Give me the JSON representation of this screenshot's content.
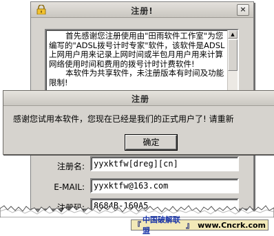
{
  "register_window": {
    "title": "注册!",
    "close_glyph": "×",
    "intro_paragraph_1": "首先感谢您注册使用由\"田雨软件工作室\"为您编写的\"ADSL拨号计时专家\"软件，该软件是ADSL上网用户用来记录上网时间或半包月用户用来计算网络使用时间和费用的拨号计时计费软件!",
    "intro_paragraph_2": "本软件为共享软件，未注册版本有时间及功能限制!",
    "fields": [
      {
        "label": "注册名:",
        "value": "yyxktfw[dreg][cn]"
      },
      {
        "label": "E-MAIL:",
        "value": "yyxktfw@163.com"
      },
      {
        "label": "注册码:",
        "value": "8684B-169A5"
      }
    ]
  },
  "message_box": {
    "title": "注册",
    "message": "感谢您试用本软件，您现在已经是我们的正式用户了! 请重新",
    "ok_label": "确定"
  },
  "watermark": {
    "bracket_open": "『",
    "name": "中国破解联盟",
    "bracket_close": "』",
    "url": "www.Cncrk.com",
    "colors": {
      "background": "#f2e9b8",
      "name": "#1733a8",
      "bracket": "#0c1a73"
    }
  },
  "icons": {
    "lock": "lock-icon",
    "scroll_up": "scroll-up-arrow-icon"
  }
}
